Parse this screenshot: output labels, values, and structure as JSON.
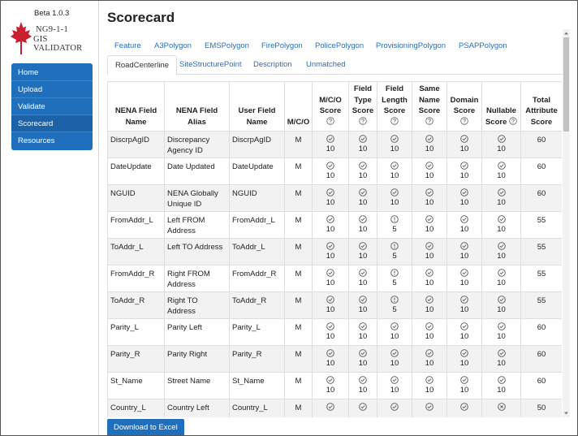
{
  "app": {
    "version": "Beta 1.0.3",
    "logo_line1": "NG9-1-1",
    "logo_line2": "GIS VALIDATOR",
    "brand_color": "#1f6fbd",
    "accent_red": "#c8202f"
  },
  "sidebar": {
    "items": [
      {
        "label": "Home"
      },
      {
        "label": "Upload"
      },
      {
        "label": "Validate"
      },
      {
        "label": "Scorecard",
        "active": true
      },
      {
        "label": "Resources"
      }
    ]
  },
  "main": {
    "title": "Scorecard",
    "tabs_row1": [
      {
        "label": "Feature"
      },
      {
        "label": "A3Polygon"
      },
      {
        "label": "EMSPolygon"
      },
      {
        "label": "FirePolygon"
      },
      {
        "label": "PolicePolygon"
      },
      {
        "label": "ProvisioningPolygon"
      },
      {
        "label": "PSAPPolygon"
      }
    ],
    "tabs_row2": [
      {
        "label": "RoadCenterline",
        "active": true
      },
      {
        "label": "SiteStructurePoint"
      },
      {
        "label": "Description"
      },
      {
        "label": "Unmatched"
      }
    ],
    "export_button": "Download to Excel"
  },
  "table": {
    "headers": {
      "nena_field_name": "NENA Field Name",
      "nena_field_alias": "NENA Field Alias",
      "user_field_name": "User Field Name",
      "mco": "M/C/O",
      "mco_score": "M/C/O Score",
      "field_type_score": "Field Type Score",
      "field_length_score": "Field Length Score",
      "same_name_score": "Same Name Score",
      "domain_score": "Domain Score",
      "nullable_score": "Nullable Score",
      "total_score": "Total Attribute Score"
    },
    "rows": [
      {
        "nena": "DiscrpAgID",
        "alias": "Discrepancy Agency ID",
        "user": "DiscrpAgID",
        "mco": "M",
        "scores": [
          {
            "icon": "check",
            "value": "10"
          },
          {
            "icon": "check",
            "value": "10"
          },
          {
            "icon": "check",
            "value": "10"
          },
          {
            "icon": "check",
            "value": "10"
          },
          {
            "icon": "check",
            "value": "10"
          },
          {
            "icon": "check",
            "value": "10"
          }
        ],
        "total": "60"
      },
      {
        "nena": "DateUpdate",
        "alias": "Date Updated",
        "user": "DateUpdate",
        "mco": "M",
        "scores": [
          {
            "icon": "check",
            "value": "10"
          },
          {
            "icon": "check",
            "value": "10"
          },
          {
            "icon": "check",
            "value": "10"
          },
          {
            "icon": "check",
            "value": "10"
          },
          {
            "icon": "check",
            "value": "10"
          },
          {
            "icon": "check",
            "value": "10"
          }
        ],
        "total": "60"
      },
      {
        "nena": "NGUID",
        "alias": "NENA Globally Unique ID",
        "user": "NGUID",
        "mco": "M",
        "scores": [
          {
            "icon": "check",
            "value": "10"
          },
          {
            "icon": "check",
            "value": "10"
          },
          {
            "icon": "check",
            "value": "10"
          },
          {
            "icon": "check",
            "value": "10"
          },
          {
            "icon": "check",
            "value": "10"
          },
          {
            "icon": "check",
            "value": "10"
          }
        ],
        "total": "60"
      },
      {
        "nena": "FromAddr_L",
        "alias": "Left FROM Address",
        "user": "FromAddr_L",
        "mco": "M",
        "scores": [
          {
            "icon": "check",
            "value": "10"
          },
          {
            "icon": "check",
            "value": "10"
          },
          {
            "icon": "warn",
            "value": "5"
          },
          {
            "icon": "check",
            "value": "10"
          },
          {
            "icon": "check",
            "value": "10"
          },
          {
            "icon": "check",
            "value": "10"
          }
        ],
        "total": "55"
      },
      {
        "nena": "ToAddr_L",
        "alias": "Left TO Address",
        "user": "ToAddr_L",
        "mco": "M",
        "scores": [
          {
            "icon": "check",
            "value": "10"
          },
          {
            "icon": "check",
            "value": "10"
          },
          {
            "icon": "warn",
            "value": "5"
          },
          {
            "icon": "check",
            "value": "10"
          },
          {
            "icon": "check",
            "value": "10"
          },
          {
            "icon": "check",
            "value": "10"
          }
        ],
        "total": "55"
      },
      {
        "nena": "FromAddr_R",
        "alias": "Right FROM Address",
        "user": "FromAddr_R",
        "mco": "M",
        "scores": [
          {
            "icon": "check",
            "value": "10"
          },
          {
            "icon": "check",
            "value": "10"
          },
          {
            "icon": "warn",
            "value": "5"
          },
          {
            "icon": "check",
            "value": "10"
          },
          {
            "icon": "check",
            "value": "10"
          },
          {
            "icon": "check",
            "value": "10"
          }
        ],
        "total": "55"
      },
      {
        "nena": "ToAddr_R",
        "alias": "Right TO Address",
        "user": "ToAddr_R",
        "mco": "M",
        "scores": [
          {
            "icon": "check",
            "value": "10"
          },
          {
            "icon": "check",
            "value": "10"
          },
          {
            "icon": "warn",
            "value": "5"
          },
          {
            "icon": "check",
            "value": "10"
          },
          {
            "icon": "check",
            "value": "10"
          },
          {
            "icon": "check",
            "value": "10"
          }
        ],
        "total": "55"
      },
      {
        "nena": "Parity_L",
        "alias": "Parity Left",
        "user": "Parity_L",
        "mco": "M",
        "scores": [
          {
            "icon": "check",
            "value": "10"
          },
          {
            "icon": "check",
            "value": "10"
          },
          {
            "icon": "check",
            "value": "10"
          },
          {
            "icon": "check",
            "value": "10"
          },
          {
            "icon": "check",
            "value": "10"
          },
          {
            "icon": "check",
            "value": "10"
          }
        ],
        "total": "60"
      },
      {
        "nena": "Parity_R",
        "alias": "Parity Right",
        "user": "Parity_R",
        "mco": "M",
        "scores": [
          {
            "icon": "check",
            "value": "10"
          },
          {
            "icon": "check",
            "value": "10"
          },
          {
            "icon": "check",
            "value": "10"
          },
          {
            "icon": "check",
            "value": "10"
          },
          {
            "icon": "check",
            "value": "10"
          },
          {
            "icon": "check",
            "value": "10"
          }
        ],
        "total": "60"
      },
      {
        "nena": "St_Name",
        "alias": "Street Name",
        "user": "St_Name",
        "mco": "M",
        "scores": [
          {
            "icon": "check",
            "value": "10"
          },
          {
            "icon": "check",
            "value": "10"
          },
          {
            "icon": "check",
            "value": "10"
          },
          {
            "icon": "check",
            "value": "10"
          },
          {
            "icon": "check",
            "value": "10"
          },
          {
            "icon": "check",
            "value": "10"
          }
        ],
        "total": "60"
      },
      {
        "nena": "Country_L",
        "alias": "Country Left",
        "user": "Country_L",
        "mco": "M",
        "scores": [
          {
            "icon": "check",
            "value": ""
          },
          {
            "icon": "check",
            "value": ""
          },
          {
            "icon": "check",
            "value": ""
          },
          {
            "icon": "check",
            "value": ""
          },
          {
            "icon": "check",
            "value": ""
          },
          {
            "icon": "cross",
            "value": ""
          }
        ],
        "total": "50"
      }
    ]
  }
}
